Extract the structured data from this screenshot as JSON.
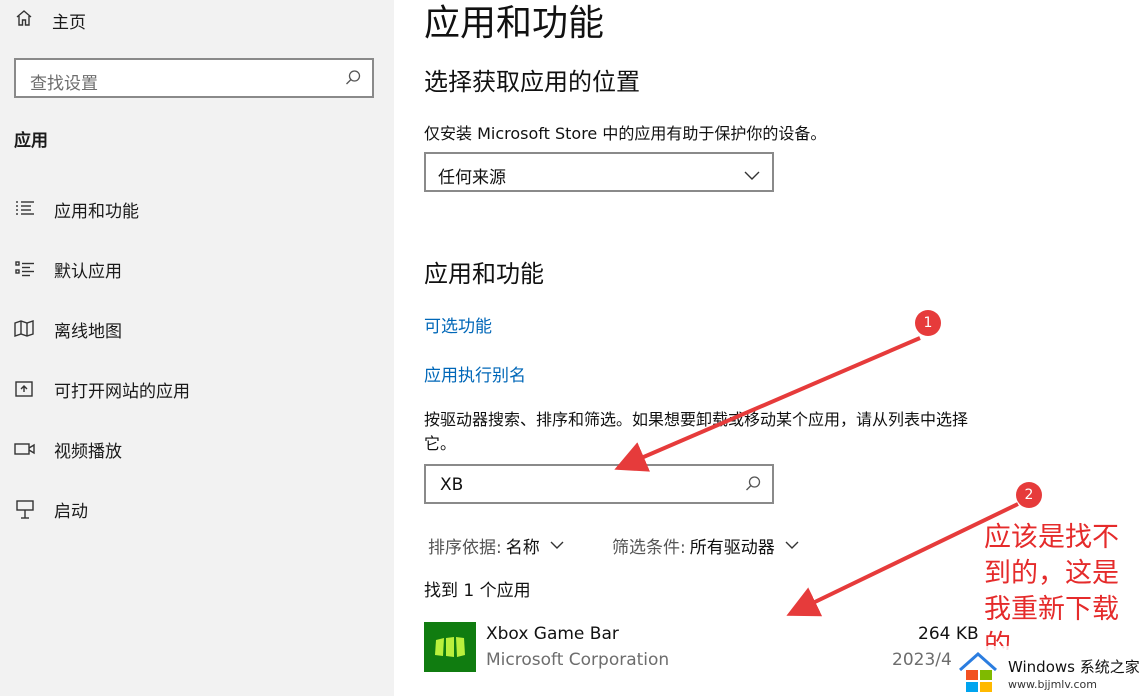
{
  "sidebar": {
    "home_label": "主页",
    "search_placeholder": "查找设置",
    "section_title": "应用",
    "items": [
      {
        "label": "应用和功能",
        "icon": "list-icon"
      },
      {
        "label": "默认应用",
        "icon": "default-apps-icon"
      },
      {
        "label": "离线地图",
        "icon": "map-icon"
      },
      {
        "label": "可打开网站的应用",
        "icon": "open-in-app-icon"
      },
      {
        "label": "视频播放",
        "icon": "video-icon"
      },
      {
        "label": "启动",
        "icon": "startup-icon"
      }
    ]
  },
  "main": {
    "title": "应用和功能",
    "source_heading": "选择获取应用的位置",
    "source_desc": "仅安装 Microsoft Store 中的应用有助于保护你的设备。",
    "source_value": "任何来源",
    "apps_heading": "应用和功能",
    "link_optional": "可选功能",
    "link_alias": "应用执行别名",
    "search_desc": "按驱动器搜索、排序和筛选。如果想要卸载或移动某个应用，请从列表中选择它。",
    "search_value": "XB",
    "sort_key": "排序依据:",
    "sort_value": "名称",
    "filter_key": "筛选条件:",
    "filter_value": "所有驱动器",
    "found_text": "找到 1 个应用",
    "apps": [
      {
        "name": "Xbox Game Bar",
        "publisher": "Microsoft Corporation",
        "size": "264 KB",
        "date": "2023/4"
      }
    ]
  },
  "annotations": {
    "badge1": "1",
    "badge2": "2",
    "note": "应该是找不到的，这是我重新下载的",
    "color": "#e63b3b"
  },
  "watermark": {
    "title": "Windows 系统之家",
    "url": "www.bjjmlv.com"
  }
}
